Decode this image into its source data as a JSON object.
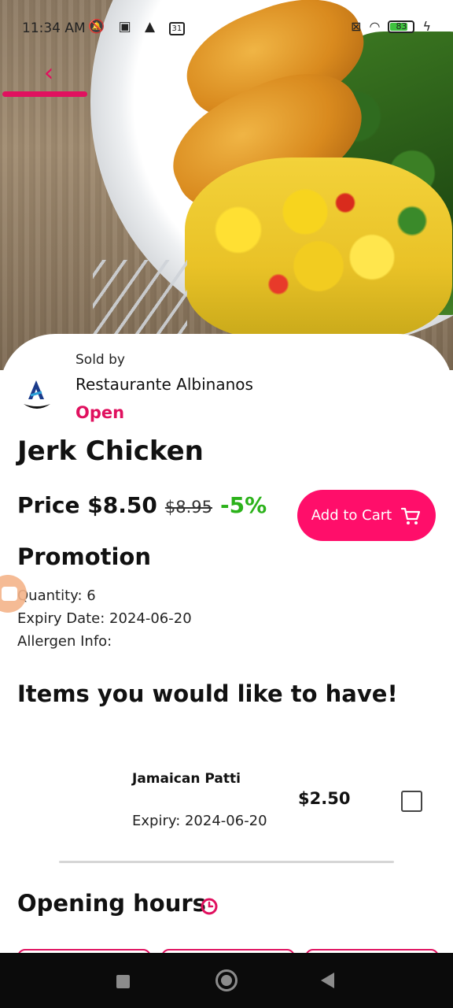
{
  "status_bar": {
    "time": "11:34 AM",
    "left_icons": [
      "bell-off-icon",
      "video-icon",
      "warning-icon",
      "calendar-icon"
    ],
    "calendar_day": "31",
    "battery_level": "83",
    "right_icons": [
      "sim-off-icon",
      "wifi-icon",
      "battery-icon",
      "charging-icon"
    ]
  },
  "header": {
    "back_icon": "chevron-left-icon"
  },
  "seller": {
    "sold_by_label": "Sold by",
    "name": "Restaurante Albinanos",
    "status": "Open"
  },
  "product": {
    "title": "Jerk Chicken",
    "price_label": "Price $8.50",
    "original_price": "$8.95",
    "discount": "-5%",
    "add_to_cart_label": "Add to Cart"
  },
  "promotion": {
    "title": "Promotion",
    "quantity": "Quantity: 6",
    "expiry": "Expiry Date: 2024-06-20",
    "allergen": "Allergen Info:"
  },
  "suggestions": {
    "title": "Items you would like to have!",
    "items": [
      {
        "name": "Jamaican Patti",
        "expiry": "Expiry: 2024-06-20",
        "price": "$2.50",
        "checked": false
      }
    ]
  },
  "opening_hours": {
    "title": "Opening hours"
  },
  "colors": {
    "accent": "#e0115f",
    "button": "#ff0e6a",
    "discount": "#2bb21a"
  }
}
